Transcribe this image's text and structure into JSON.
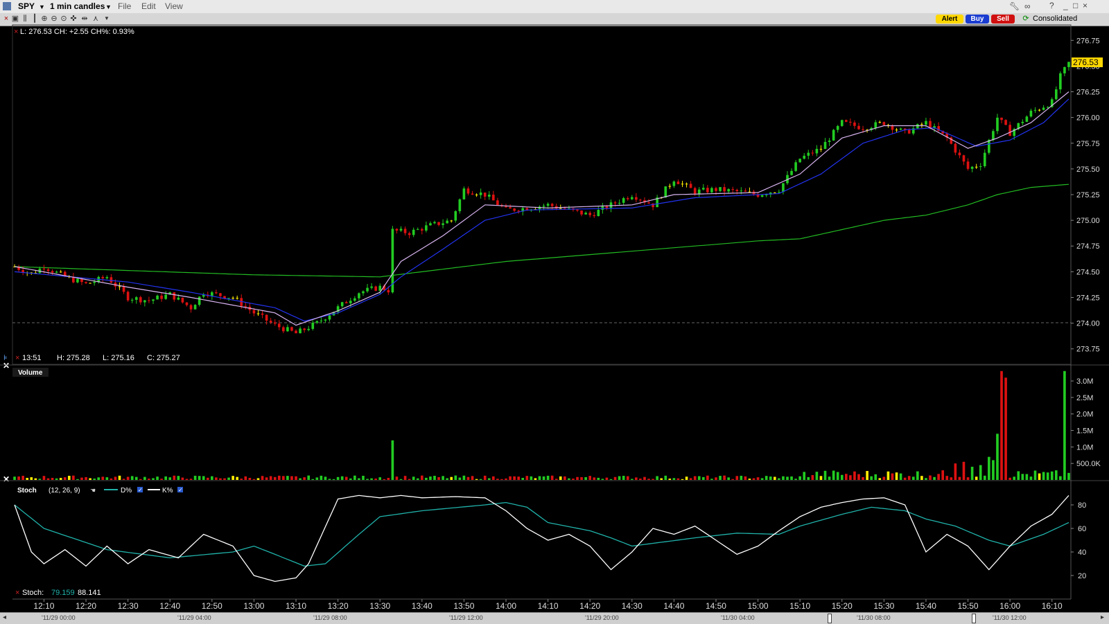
{
  "window": {
    "symbol": "SPY",
    "timeframe": "1 min candles",
    "menu": [
      "File",
      "Edit",
      "View"
    ]
  },
  "toolbar": {
    "alert": "Alert",
    "buy": "Buy",
    "sell": "Sell",
    "feed": "Consolidated"
  },
  "colors": {
    "up": "#22cc22",
    "down": "#dd1111",
    "neutral": "#ffee00",
    "ma_fast": "#d8b4f0",
    "ma_slow": "#2233ee",
    "vwap": "#22bb22",
    "stoch_d": "#20b2aa",
    "stoch_k": "#ffffff",
    "last_price_bg": "#ffd700"
  },
  "price_panel": {
    "header": "L: 276.53 CH: +2.55 CH%: 0.93%",
    "crosshair_time": "13:51",
    "crosshair_h": "H: 275.28",
    "crosshair_l": "L: 275.16",
    "crosshair_c": "C: 275.27",
    "last_price": "276.53",
    "ticks": [
      "276.75",
      "276.50",
      "276.25",
      "276.00",
      "275.75",
      "275.50",
      "275.25",
      "275.00",
      "274.75",
      "274.50",
      "274.25",
      "274.00",
      "273.75"
    ]
  },
  "volume_panel": {
    "title": "Volume",
    "ticks": [
      "3.0M",
      "2.5M",
      "2.0M",
      "1.5M",
      "1.0M",
      "500.0K"
    ]
  },
  "stoch_panel": {
    "title": "Stoch",
    "params": "(12, 26, 9)",
    "d_label": "D%",
    "k_label": "K%",
    "readout_label": "Stoch:",
    "readout_d": "79.159",
    "readout_k": "88.141",
    "ticks": [
      "80",
      "60",
      "40",
      "20"
    ]
  },
  "time_axis": [
    "12:10",
    "12:20",
    "12:30",
    "12:40",
    "12:50",
    "13:00",
    "13:10",
    "13:20",
    "13:30",
    "13:40",
    "13:50",
    "14:00",
    "14:10",
    "14:20",
    "14:30",
    "14:40",
    "14:50",
    "15:00",
    "15:10",
    "15:20",
    "15:30",
    "15:40",
    "15:50",
    "16:00",
    "16:10"
  ],
  "timeline_labels": [
    "'11/29 00:00",
    "'11/29 04:00",
    "'11/29 08:00",
    "'11/29 12:00",
    "'11/29 20:00",
    "'11/30 04:00",
    "'11/30 08:00",
    "'11/30 12:00"
  ],
  "chart_data": [
    {
      "type": "candlestick",
      "title": "SPY 1 min candles",
      "ylim": [
        273.6,
        276.9
      ],
      "x_range": [
        "12:03",
        "16:14"
      ],
      "close_anchors": [
        [
          "12:03",
          274.55
        ],
        [
          "12:07",
          274.48
        ],
        [
          "12:10",
          274.55
        ],
        [
          "12:15",
          274.45
        ],
        [
          "12:20",
          274.38
        ],
        [
          "12:25",
          274.45
        ],
        [
          "12:30",
          274.25
        ],
        [
          "12:35",
          274.22
        ],
        [
          "12:40",
          274.28
        ],
        [
          "12:45",
          274.15
        ],
        [
          "12:48",
          274.3
        ],
        [
          "12:55",
          274.25
        ],
        [
          "13:00",
          274.1
        ],
        [
          "13:05",
          273.98
        ],
        [
          "13:10",
          273.9
        ],
        [
          "13:15",
          274.0
        ],
        [
          "13:20",
          274.15
        ],
        [
          "13:25",
          274.3
        ],
        [
          "13:30",
          274.35
        ],
        [
          "13:32",
          274.32
        ],
        [
          "13:33",
          274.9
        ],
        [
          "13:37",
          274.88
        ],
        [
          "13:42",
          274.95
        ],
        [
          "13:47",
          275.0
        ],
        [
          "13:50",
          275.3
        ],
        [
          "13:55",
          275.25
        ],
        [
          "14:00",
          275.1
        ],
        [
          "14:05",
          275.12
        ],
        [
          "14:10",
          275.15
        ],
        [
          "14:15",
          275.1
        ],
        [
          "14:20",
          275.05
        ],
        [
          "14:25",
          275.15
        ],
        [
          "14:30",
          275.25
        ],
        [
          "14:35",
          275.15
        ],
        [
          "14:40",
          275.4
        ],
        [
          "14:45",
          275.28
        ],
        [
          "14:50",
          275.3
        ],
        [
          "14:55",
          275.28
        ],
        [
          "15:00",
          275.25
        ],
        [
          "15:05",
          275.3
        ],
        [
          "15:10",
          275.6
        ],
        [
          "15:15",
          275.7
        ],
        [
          "15:20",
          275.95
        ],
        [
          "15:25",
          275.9
        ],
        [
          "15:30",
          275.95
        ],
        [
          "15:35",
          275.85
        ],
        [
          "15:40",
          275.95
        ],
        [
          "15:45",
          275.8
        ],
        [
          "15:50",
          275.5
        ],
        [
          "15:53",
          275.55
        ],
        [
          "15:57",
          276.0
        ],
        [
          "16:00",
          275.85
        ],
        [
          "16:05",
          276.05
        ],
        [
          "16:10",
          276.15
        ],
        [
          "16:12",
          276.4
        ],
        [
          "16:14",
          276.53
        ]
      ],
      "ma_fast_anchors": [
        [
          "12:03",
          274.55
        ],
        [
          "12:30",
          274.35
        ],
        [
          "12:45",
          274.25
        ],
        [
          "13:05",
          274.1
        ],
        [
          "13:10",
          273.98
        ],
        [
          "13:20",
          274.12
        ],
        [
          "13:30",
          274.3
        ],
        [
          "13:35",
          274.6
        ],
        [
          "13:45",
          274.85
        ],
        [
          "13:55",
          275.15
        ],
        [
          "14:10",
          275.12
        ],
        [
          "14:30",
          275.15
        ],
        [
          "14:40",
          275.25
        ],
        [
          "15:00",
          275.27
        ],
        [
          "15:10",
          275.45
        ],
        [
          "15:20",
          275.8
        ],
        [
          "15:30",
          275.92
        ],
        [
          "15:40",
          275.92
        ],
        [
          "15:50",
          275.7
        ],
        [
          "15:57",
          275.8
        ],
        [
          "16:05",
          275.95
        ],
        [
          "16:14",
          276.25
        ]
      ],
      "ma_slow_anchors": [
        [
          "12:03",
          274.5
        ],
        [
          "12:30",
          274.4
        ],
        [
          "12:45",
          274.3
        ],
        [
          "13:05",
          274.15
        ],
        [
          "13:12",
          274.02
        ],
        [
          "13:20",
          274.1
        ],
        [
          "13:30",
          274.28
        ],
        [
          "13:35",
          274.45
        ],
        [
          "13:45",
          274.72
        ],
        [
          "13:55",
          275.0
        ],
        [
          "14:05",
          275.1
        ],
        [
          "14:30",
          275.12
        ],
        [
          "14:45",
          275.22
        ],
        [
          "15:05",
          275.26
        ],
        [
          "15:15",
          275.45
        ],
        [
          "15:25",
          275.75
        ],
        [
          "15:35",
          275.88
        ],
        [
          "15:42",
          275.9
        ],
        [
          "15:52",
          275.72
        ],
        [
          "16:00",
          275.78
        ],
        [
          "16:08",
          275.95
        ],
        [
          "16:14",
          276.18
        ]
      ],
      "vwap_anchors": [
        [
          "12:03",
          274.55
        ],
        [
          "13:00",
          274.47
        ],
        [
          "13:30",
          274.45
        ],
        [
          "13:40",
          274.5
        ],
        [
          "14:00",
          274.6
        ],
        [
          "14:30",
          274.7
        ],
        [
          "15:00",
          274.8
        ],
        [
          "15:10",
          274.82
        ],
        [
          "15:30",
          275.0
        ],
        [
          "15:40",
          275.05
        ],
        [
          "15:50",
          275.15
        ],
        [
          "15:57",
          275.25
        ],
        [
          "16:05",
          275.32
        ],
        [
          "16:14",
          275.35
        ]
      ]
    },
    {
      "type": "bar",
      "title": "Volume",
      "ylim": [
        0,
        3400000
      ],
      "baseline": 80000,
      "spikes": [
        [
          "13:33",
          1200000
        ],
        [
          "15:55",
          700000
        ],
        [
          "15:57",
          1400000
        ],
        [
          "15:58",
          3300000
        ],
        [
          "15:59",
          3100000
        ],
        [
          "16:13",
          3300000
        ],
        [
          "15:47",
          500000
        ],
        [
          "15:49",
          550000
        ],
        [
          "15:51",
          400000
        ],
        [
          "15:53",
          450000
        ],
        [
          "15:56",
          600000
        ]
      ]
    },
    {
      "type": "line",
      "title": "Stoch",
      "ylim": [
        0,
        100
      ],
      "series": [
        {
          "name": "D%",
          "points": [
            [
              "12:03",
              80
            ],
            [
              "12:10",
              60
            ],
            [
              "12:20",
              48
            ],
            [
              "12:25",
              42
            ],
            [
              "12:40",
              35
            ],
            [
              "12:55",
              40
            ],
            [
              "13:00",
              45
            ],
            [
              "13:05",
              38
            ],
            [
              "13:12",
              28
            ],
            [
              "13:17",
              30
            ],
            [
              "13:25",
              55
            ],
            [
              "13:30",
              70
            ],
            [
              "13:40",
              75
            ],
            [
              "13:55",
              80
            ],
            [
              "14:00",
              82
            ],
            [
              "14:05",
              78
            ],
            [
              "14:10",
              65
            ],
            [
              "14:20",
              58
            ],
            [
              "14:25",
              52
            ],
            [
              "14:30",
              45
            ],
            [
              "14:45",
              52
            ],
            [
              "14:55",
              56
            ],
            [
              "15:05",
              55
            ],
            [
              "15:10",
              62
            ],
            [
              "15:20",
              72
            ],
            [
              "15:27",
              78
            ],
            [
              "15:35",
              75
            ],
            [
              "15:40",
              68
            ],
            [
              "15:47",
              62
            ],
            [
              "15:55",
              50
            ],
            [
              "16:00",
              45
            ],
            [
              "16:08",
              55
            ],
            [
              "16:14",
              65
            ]
          ]
        },
        {
          "name": "K%",
          "points": [
            [
              "12:03",
              80
            ],
            [
              "12:07",
              40
            ],
            [
              "12:10",
              30
            ],
            [
              "12:15",
              42
            ],
            [
              "12:20",
              28
            ],
            [
              "12:25",
              45
            ],
            [
              "12:30",
              30
            ],
            [
              "12:35",
              42
            ],
            [
              "12:42",
              35
            ],
            [
              "12:48",
              55
            ],
            [
              "12:55",
              45
            ],
            [
              "13:00",
              20
            ],
            [
              "13:05",
              15
            ],
            [
              "13:10",
              18
            ],
            [
              "13:13",
              30
            ],
            [
              "13:20",
              85
            ],
            [
              "13:25",
              88
            ],
            [
              "13:30",
              86
            ],
            [
              "13:35",
              88
            ],
            [
              "13:40",
              86
            ],
            [
              "13:48",
              87
            ],
            [
              "13:55",
              86
            ],
            [
              "14:00",
              75
            ],
            [
              "14:05",
              60
            ],
            [
              "14:10",
              50
            ],
            [
              "14:15",
              55
            ],
            [
              "14:20",
              45
            ],
            [
              "14:25",
              25
            ],
            [
              "14:30",
              40
            ],
            [
              "14:35",
              60
            ],
            [
              "14:40",
              55
            ],
            [
              "14:45",
              62
            ],
            [
              "14:50",
              50
            ],
            [
              "14:55",
              38
            ],
            [
              "15:00",
              45
            ],
            [
              "15:05",
              58
            ],
            [
              "15:10",
              70
            ],
            [
              "15:15",
              78
            ],
            [
              "15:20",
              82
            ],
            [
              "15:25",
              85
            ],
            [
              "15:30",
              86
            ],
            [
              "15:35",
              80
            ],
            [
              "15:40",
              40
            ],
            [
              "15:45",
              55
            ],
            [
              "15:50",
              45
            ],
            [
              "15:55",
              25
            ],
            [
              "16:00",
              45
            ],
            [
              "16:05",
              62
            ],
            [
              "16:10",
              72
            ],
            [
              "16:14",
              88
            ]
          ]
        }
      ]
    }
  ]
}
